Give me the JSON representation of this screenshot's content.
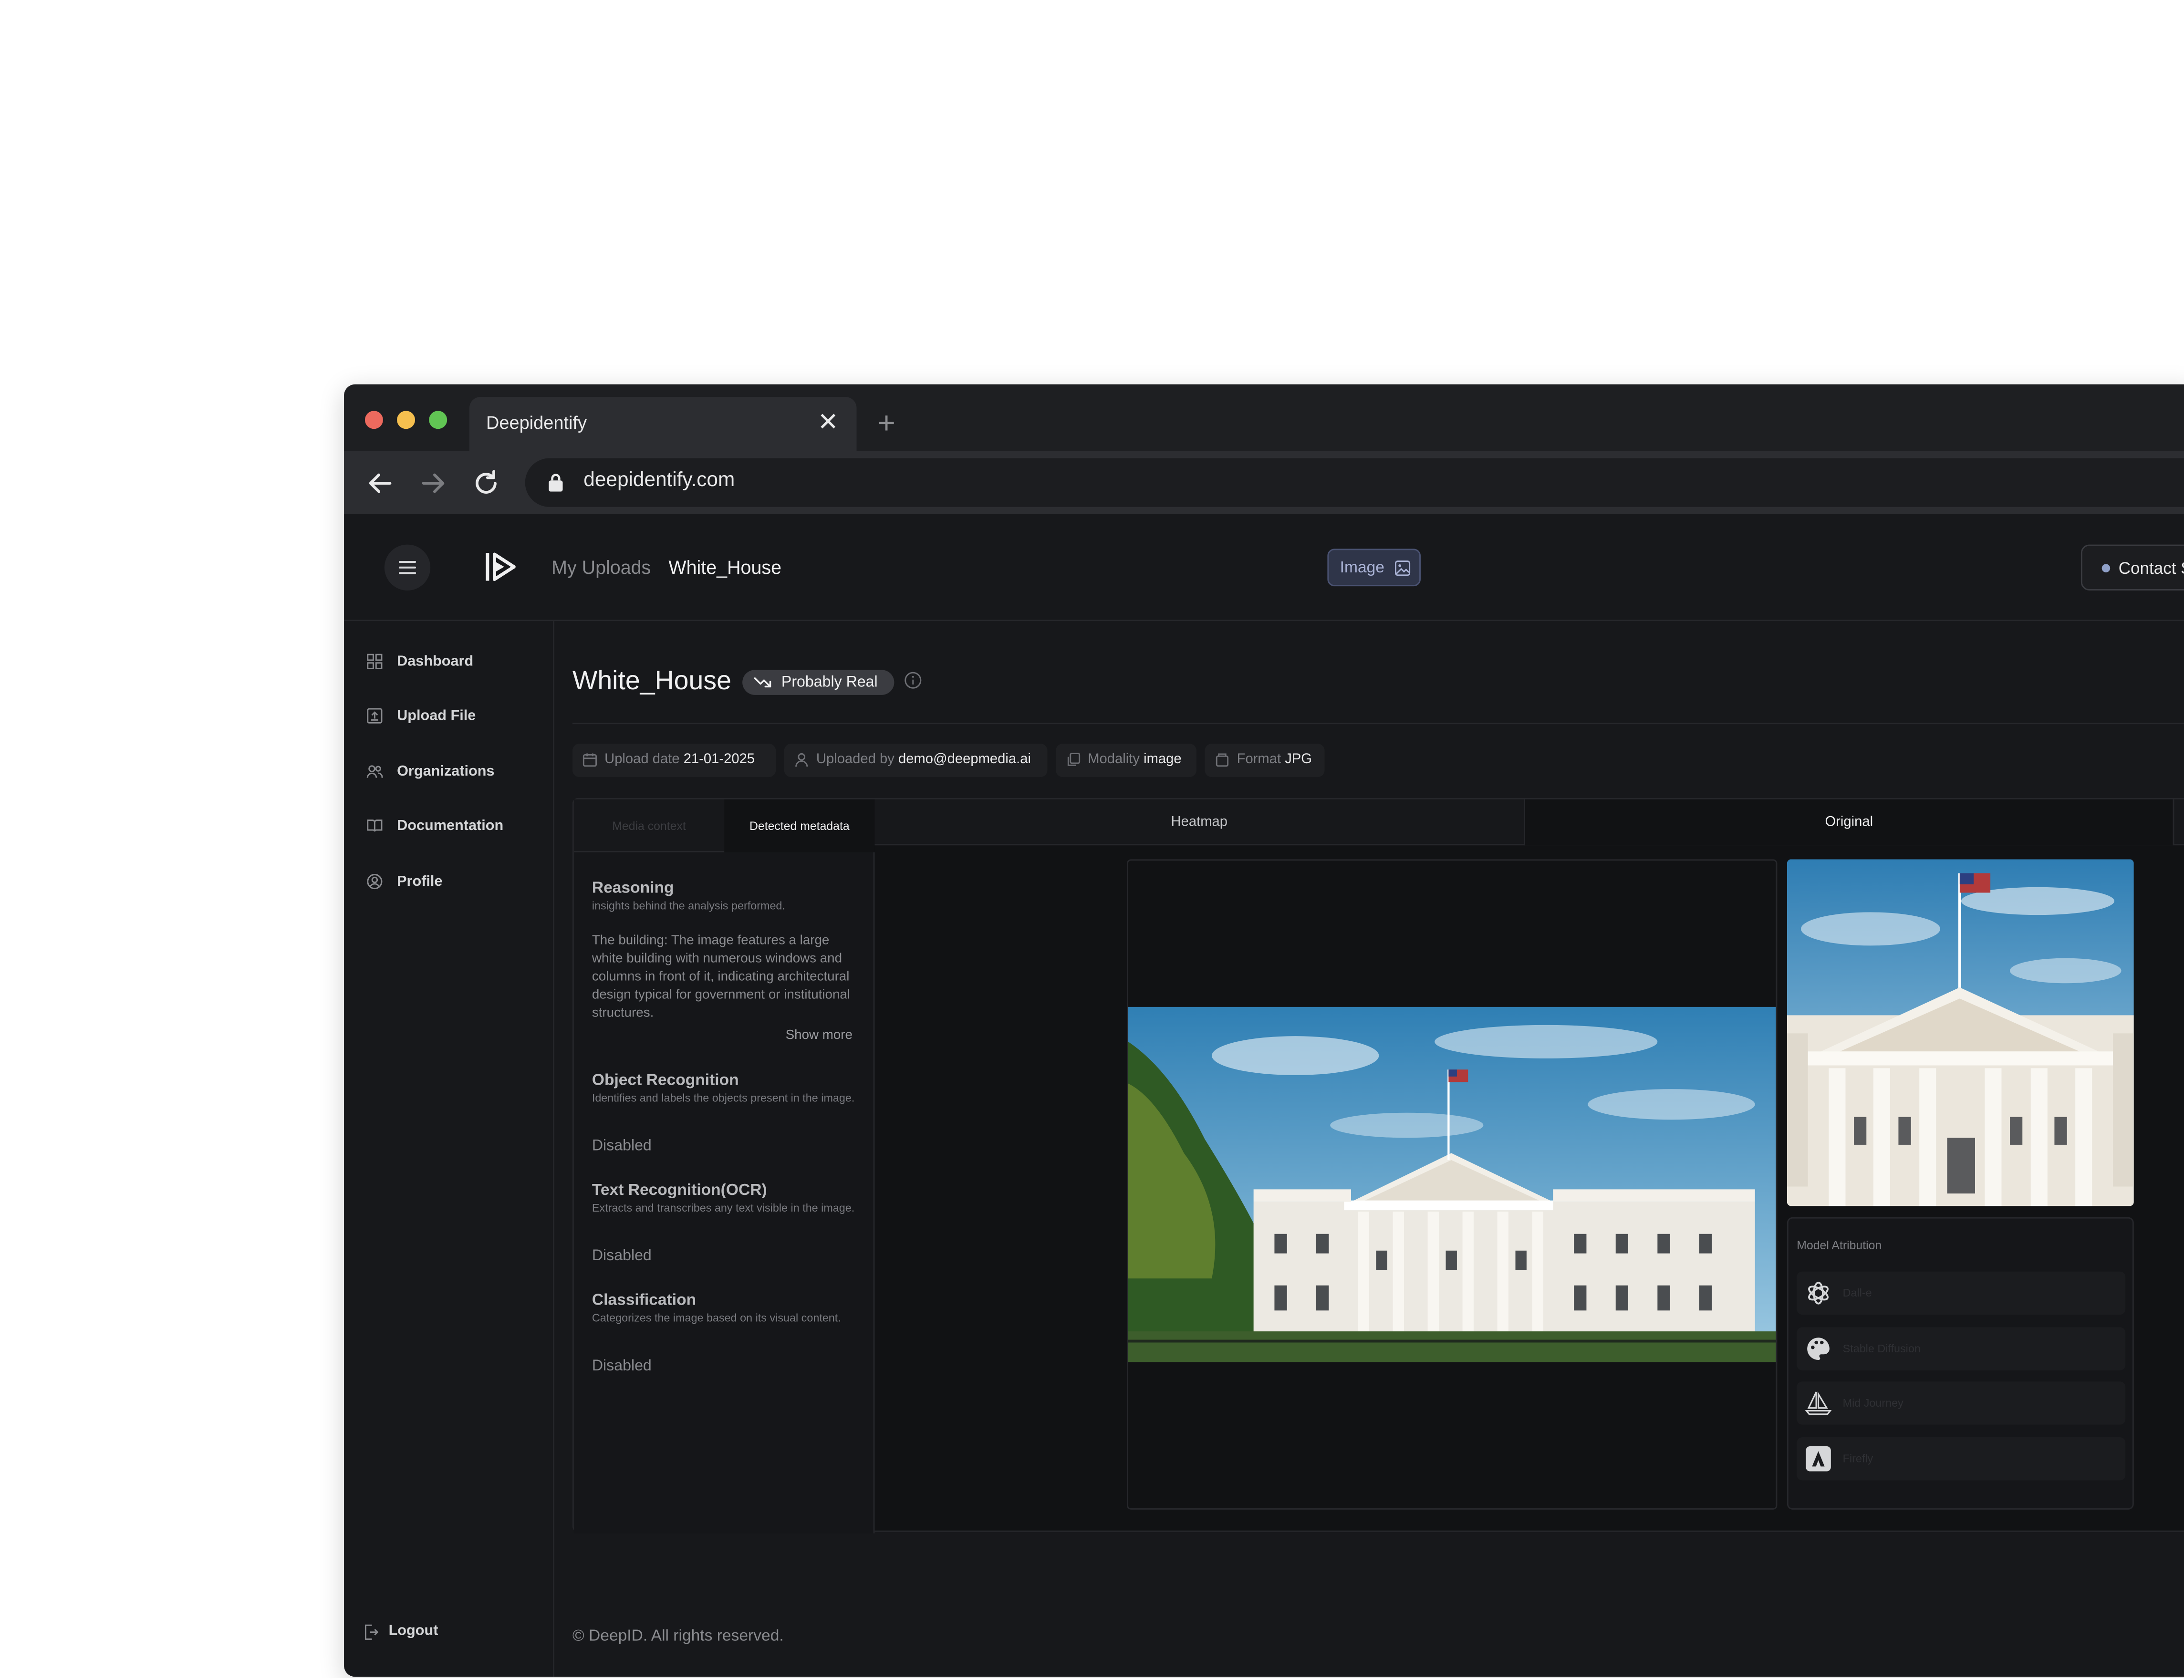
{
  "browser": {
    "tab_title": "Deepidentify",
    "url": "deepidentify.com",
    "traffic_lights": [
      "#ed6a5e",
      "#f5bf4f",
      "#61c554"
    ]
  },
  "header": {
    "breadcrumb_parent": "My Uploads",
    "breadcrumb_current": "White_House",
    "modality_badge": "Image",
    "contact_button": "Contact S"
  },
  "sidebar": {
    "items": [
      {
        "label": "Dashboard",
        "icon": "grid-icon"
      },
      {
        "label": "Upload File",
        "icon": "upload-icon"
      },
      {
        "label": "Organizations",
        "icon": "users-icon"
      },
      {
        "label": "Documentation",
        "icon": "book-icon"
      },
      {
        "label": "Profile",
        "icon": "user-circle-icon"
      }
    ],
    "logout": "Logout"
  },
  "page": {
    "title": "White_House",
    "verdict": "Probably Real",
    "meta": [
      {
        "key": "Upload date",
        "value": "21-01-2025",
        "icon": "calendar-icon"
      },
      {
        "key": "Uploaded by",
        "value": "demo@deepmedia.ai",
        "icon": "user-icon"
      },
      {
        "key": "Modality",
        "value": "image",
        "icon": "copy-icon"
      },
      {
        "key": "Format",
        "value": "JPG",
        "icon": "file-icon"
      }
    ]
  },
  "left_tabs": [
    "Media context",
    "Detected metadata"
  ],
  "analysis": {
    "reasoning": {
      "title": "Reasoning",
      "desc": "insights behind the analysis performed.",
      "text": "The building: The image features a large white building with numerous windows and columns in front of it, indicating architectural design typical for government or institutional structures.",
      "show_more": "Show more"
    },
    "object_recognition": {
      "title": "Object Recognition",
      "desc": "Identifies and labels the objects present in the image.",
      "status": "Disabled"
    },
    "ocr": {
      "title": "Text Recognition(OCR)",
      "desc": "Extracts and transcribes any text visible in the image.",
      "status": "Disabled"
    },
    "classification": {
      "title": "Classification",
      "desc": "Categorizes the image based on its visual content.",
      "status": "Disabled"
    }
  },
  "view_tabs": [
    "Heatmap",
    "Original"
  ],
  "model_attribution": {
    "title": "Model Atribution",
    "models": [
      {
        "name": "Dall-e",
        "icon": "openai-icon"
      },
      {
        "name": "Stable Diffusion",
        "icon": "palette-icon"
      },
      {
        "name": "Mid Journey",
        "icon": "sailboat-icon"
      },
      {
        "name": "Firefly",
        "icon": "adobe-icon"
      }
    ]
  },
  "footer": "© DeepID. All rights reserved."
}
